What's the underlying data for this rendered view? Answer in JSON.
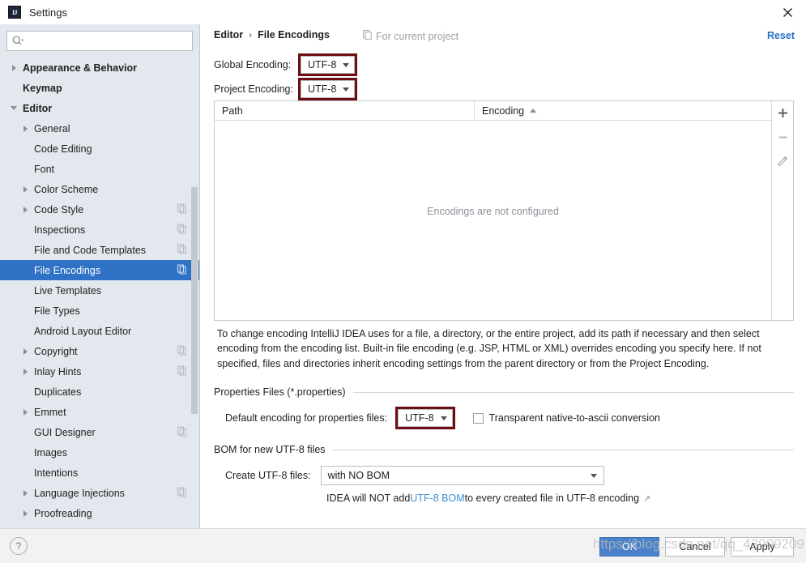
{
  "window": {
    "title": "Settings",
    "logo_text": "IJ",
    "close_icon": "close-icon"
  },
  "search": {
    "value": "",
    "placeholder": ""
  },
  "sidebar": {
    "items": [
      {
        "label": "Appearance & Behavior",
        "indent": 1,
        "twisty": "right",
        "bold": true,
        "selected": false,
        "project_icon": false
      },
      {
        "label": "Keymap",
        "indent": 1,
        "twisty": "none",
        "bold": true,
        "selected": false,
        "project_icon": false
      },
      {
        "label": "Editor",
        "indent": 1,
        "twisty": "down",
        "bold": true,
        "selected": false,
        "project_icon": false
      },
      {
        "label": "General",
        "indent": 2,
        "twisty": "right",
        "bold": false,
        "selected": false,
        "project_icon": false
      },
      {
        "label": "Code Editing",
        "indent": 2,
        "twisty": "none",
        "bold": false,
        "selected": false,
        "project_icon": false
      },
      {
        "label": "Font",
        "indent": 2,
        "twisty": "none",
        "bold": false,
        "selected": false,
        "project_icon": false
      },
      {
        "label": "Color Scheme",
        "indent": 2,
        "twisty": "right",
        "bold": false,
        "selected": false,
        "project_icon": false
      },
      {
        "label": "Code Style",
        "indent": 2,
        "twisty": "right",
        "bold": false,
        "selected": false,
        "project_icon": true
      },
      {
        "label": "Inspections",
        "indent": 2,
        "twisty": "none",
        "bold": false,
        "selected": false,
        "project_icon": true
      },
      {
        "label": "File and Code Templates",
        "indent": 2,
        "twisty": "none",
        "bold": false,
        "selected": false,
        "project_icon": true
      },
      {
        "label": "File Encodings",
        "indent": 2,
        "twisty": "none",
        "bold": false,
        "selected": true,
        "project_icon": true
      },
      {
        "label": "Live Templates",
        "indent": 2,
        "twisty": "none",
        "bold": false,
        "selected": false,
        "project_icon": false
      },
      {
        "label": "File Types",
        "indent": 2,
        "twisty": "none",
        "bold": false,
        "selected": false,
        "project_icon": false
      },
      {
        "label": "Android Layout Editor",
        "indent": 2,
        "twisty": "none",
        "bold": false,
        "selected": false,
        "project_icon": false
      },
      {
        "label": "Copyright",
        "indent": 2,
        "twisty": "right",
        "bold": false,
        "selected": false,
        "project_icon": true
      },
      {
        "label": "Inlay Hints",
        "indent": 2,
        "twisty": "right",
        "bold": false,
        "selected": false,
        "project_icon": true
      },
      {
        "label": "Duplicates",
        "indent": 2,
        "twisty": "none",
        "bold": false,
        "selected": false,
        "project_icon": false
      },
      {
        "label": "Emmet",
        "indent": 2,
        "twisty": "right",
        "bold": false,
        "selected": false,
        "project_icon": false
      },
      {
        "label": "GUI Designer",
        "indent": 2,
        "twisty": "none",
        "bold": false,
        "selected": false,
        "project_icon": true
      },
      {
        "label": "Images",
        "indent": 2,
        "twisty": "none",
        "bold": false,
        "selected": false,
        "project_icon": false
      },
      {
        "label": "Intentions",
        "indent": 2,
        "twisty": "none",
        "bold": false,
        "selected": false,
        "project_icon": false
      },
      {
        "label": "Language Injections",
        "indent": 2,
        "twisty": "right",
        "bold": false,
        "selected": false,
        "project_icon": true
      },
      {
        "label": "Proofreading",
        "indent": 2,
        "twisty": "right",
        "bold": false,
        "selected": false,
        "project_icon": false
      }
    ]
  },
  "header": {
    "breadcrumb_parent": "Editor",
    "breadcrumb_separator": "›",
    "breadcrumb_current": "File Encodings",
    "scope_label": "For current project",
    "reset_label": "Reset"
  },
  "encodings": {
    "global_label": "Global Encoding:",
    "global_value": "UTF-8",
    "project_label": "Project Encoding:",
    "project_value": "UTF-8"
  },
  "table": {
    "columns": [
      "Path",
      "Encoding"
    ],
    "sort_column": "Encoding",
    "sort_direction": "asc",
    "rows": [],
    "empty_message": "Encodings are not configured",
    "tools": {
      "add": "plus-icon",
      "remove": "minus-icon",
      "edit": "pencil-icon"
    }
  },
  "description": "To change encoding IntelliJ IDEA uses for a file, a directory, or the entire project, add its path if necessary and then select encoding from the encoding list. Built-in file encoding (e.g. JSP, HTML or XML) overrides encoding you specify here. If not specified, files and directories inherit encoding settings from the parent directory or from the Project Encoding.",
  "properties_section": {
    "title": "Properties Files (*.properties)",
    "default_encoding_label": "Default encoding for properties files:",
    "default_encoding_value": "UTF-8",
    "transparent_label": "Transparent native-to-ascii conversion",
    "transparent_checked": false
  },
  "bom_section": {
    "title": "BOM for new UTF-8 files",
    "create_label": "Create UTF-8 files:",
    "create_value": "with NO BOM",
    "note_prefix": "IDEA will NOT add ",
    "note_link": "UTF-8 BOM",
    "note_suffix": " to every created file in UTF-8 encoding",
    "external_arrow": "↗"
  },
  "footer": {
    "help_label": "?",
    "ok_label": "OK",
    "cancel_label": "Cancel",
    "apply_label": "Apply"
  },
  "watermark": {
    "text": "https://blog.csdn.net/qq_43909209"
  },
  "colors": {
    "selection_blue": "#2f72c6",
    "link_blue": "#2470c4",
    "bom_link_blue": "#3b8ed0",
    "annotation_maroon": "#6d0f12",
    "sidebar_bg": "#e3e8ee",
    "primary_button": "#4a81c8"
  }
}
